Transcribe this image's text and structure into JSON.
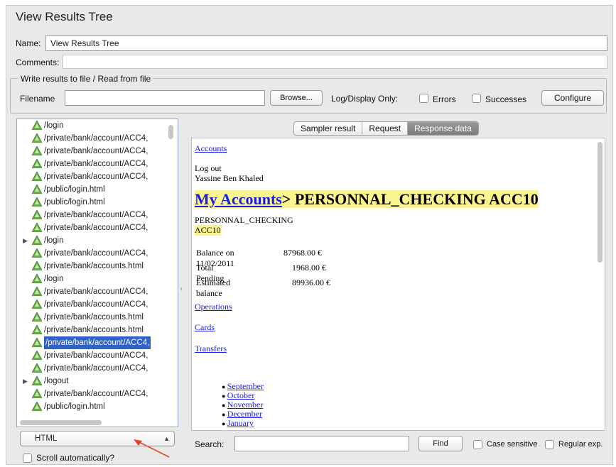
{
  "title": "View Results Tree",
  "name_label": "Name:",
  "name_value": "View Results Tree",
  "comments_label": "Comments:",
  "file_group_title": "Write results to file / Read from file",
  "filename_label": "Filename",
  "filename_value": "",
  "browse_label": "Browse...",
  "log_display_label": "Log/Display Only:",
  "errors_label": "Errors",
  "successes_label": "Successes",
  "configure_label": "Configure",
  "tree_items": [
    {
      "label": "/login",
      "expandable": false,
      "selected": false
    },
    {
      "label": "/private/bank/account/ACC4,",
      "expandable": false,
      "selected": false
    },
    {
      "label": "/private/bank/account/ACC4,",
      "expandable": false,
      "selected": false
    },
    {
      "label": "/private/bank/account/ACC4,",
      "expandable": false,
      "selected": false
    },
    {
      "label": "/private/bank/account/ACC4,",
      "expandable": false,
      "selected": false
    },
    {
      "label": "/public/login.html",
      "expandable": false,
      "selected": false
    },
    {
      "label": "/public/login.html",
      "expandable": false,
      "selected": false
    },
    {
      "label": "/private/bank/account/ACC4,",
      "expandable": false,
      "selected": false
    },
    {
      "label": "/private/bank/account/ACC4,",
      "expandable": false,
      "selected": false
    },
    {
      "label": "/login",
      "expandable": true,
      "selected": false
    },
    {
      "label": "/private/bank/account/ACC4,",
      "expandable": false,
      "selected": false
    },
    {
      "label": "/private/bank/accounts.html",
      "expandable": false,
      "selected": false
    },
    {
      "label": "/login",
      "expandable": false,
      "selected": false
    },
    {
      "label": "/private/bank/account/ACC4,",
      "expandable": false,
      "selected": false
    },
    {
      "label": "/private/bank/account/ACC4,",
      "expandable": false,
      "selected": false
    },
    {
      "label": "/private/bank/accounts.html",
      "expandable": false,
      "selected": false
    },
    {
      "label": "/private/bank/accounts.html",
      "expandable": false,
      "selected": false
    },
    {
      "label": "/private/bank/account/ACC4,",
      "expandable": false,
      "selected": true
    },
    {
      "label": "/private/bank/account/ACC4,",
      "expandable": false,
      "selected": false
    },
    {
      "label": "/private/bank/account/ACC4,",
      "expandable": false,
      "selected": false
    },
    {
      "label": "/logout",
      "expandable": true,
      "selected": false
    },
    {
      "label": "/private/bank/account/ACC4,",
      "expandable": false,
      "selected": false
    },
    {
      "label": "/public/login.html",
      "expandable": false,
      "selected": false
    }
  ],
  "renderer_select": "HTML",
  "scroll_auto_label": "Scroll automatically?",
  "tabs": [
    {
      "label": "Sampler result",
      "active": false
    },
    {
      "label": "Request",
      "active": false
    },
    {
      "label": "Response data",
      "active": true
    }
  ],
  "response": {
    "accounts_link": "Accounts",
    "logout": "Log out",
    "user": "Yassine Ben Khaled",
    "heading_link": "My Accounts",
    "heading_rest": "> PERSONNAL_CHECKING ACC10",
    "account_type": "PERSONNAL_CHECKING",
    "account_id": "ACC10",
    "balance_rows": [
      {
        "label": "Balance on 11/02/2011",
        "value": "87968.00 €"
      },
      {
        "label": "Total Pending",
        "value": "1968.00 €"
      },
      {
        "label": "Estimated balance",
        "value": "89936.00 €"
      }
    ],
    "operations_link": "Operations",
    "cards_link": "Cards",
    "transfers_link": "Transfers",
    "months": [
      "September",
      "October",
      "November",
      "December",
      "January"
    ]
  },
  "search_label": "Search:",
  "search_value": "",
  "find_label": "Find",
  "case_sensitive_label": "Case sensitive",
  "regex_label": "Regular exp.",
  "colors": {
    "selection": "#2e62c8",
    "highlight": "#fbf58f",
    "link": "#1a1ae6",
    "annotation_arrow": "#e0452b"
  }
}
